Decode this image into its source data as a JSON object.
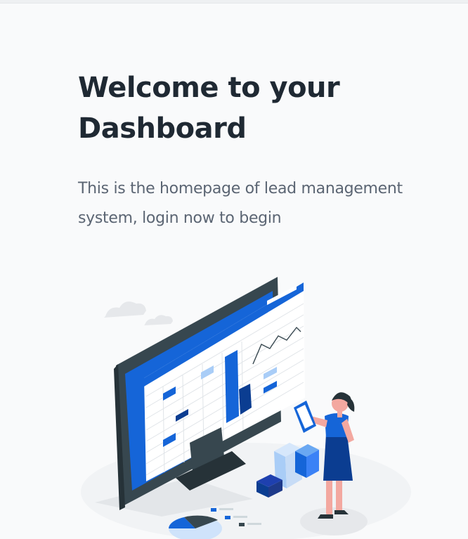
{
  "hero": {
    "title": "Welcome to your Dashboard",
    "subtitle": "This is the homepage of lead management system, login now to begin"
  },
  "illustration": {
    "icon": "dashboard-illustration",
    "colors": {
      "primary_blue": "#1565d8",
      "dark_navy": "#0b3d91",
      "light_blue": "#a9cdf7",
      "monitor": "#37474f",
      "shadow": "#eceff1"
    }
  }
}
